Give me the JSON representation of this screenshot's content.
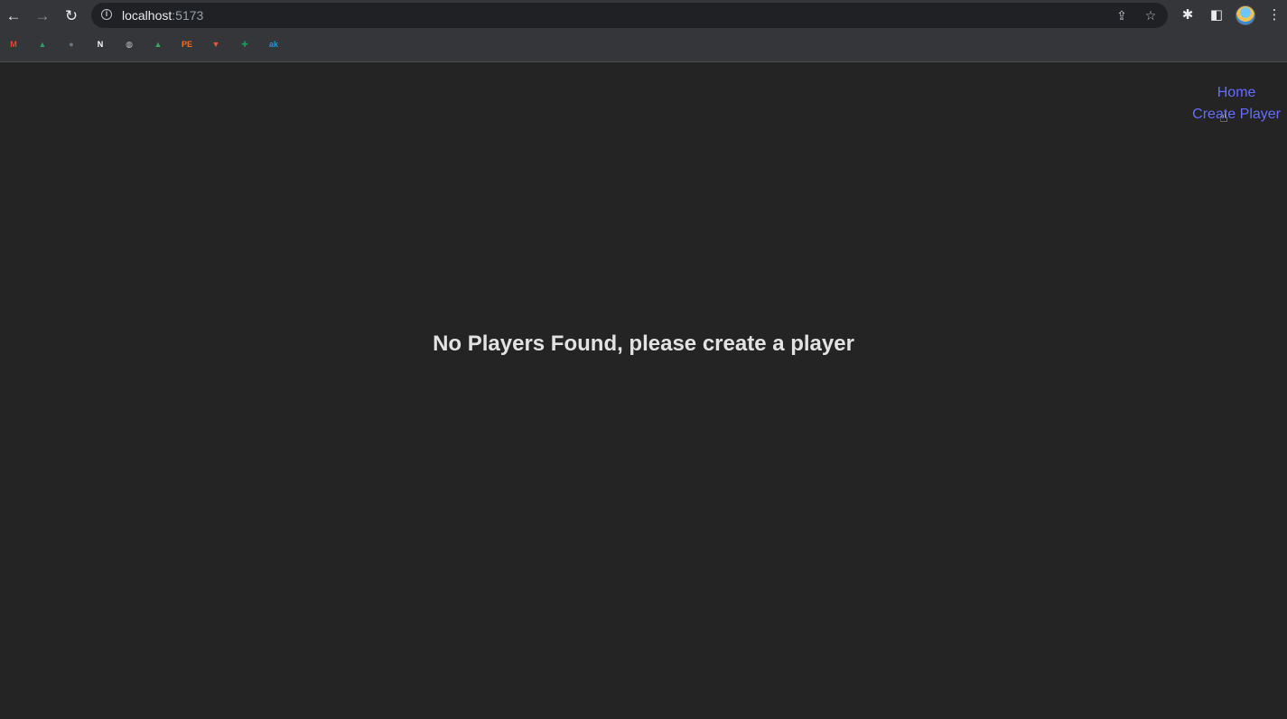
{
  "browser": {
    "url_host": "localhost",
    "url_port": ":5173",
    "nav": {
      "back_icon": "arrow-left-icon",
      "forward_icon": "arrow-right-icon",
      "reload_icon": "reload-icon"
    },
    "bookmarks": [
      {
        "name": "gmail-icon",
        "glyph": "M",
        "color": "#ea4335"
      },
      {
        "name": "google-drive-icon",
        "glyph": "▲",
        "color": "#1fa463"
      },
      {
        "name": "github-icon",
        "glyph": "●",
        "color": "#6e7681"
      },
      {
        "name": "notion-icon",
        "glyph": "N",
        "color": "#ffffff"
      },
      {
        "name": "globe-icon",
        "glyph": "◍",
        "color": "#bdc1c6"
      },
      {
        "name": "rocket-icon",
        "glyph": "▲",
        "color": "#34a853"
      },
      {
        "name": "pe-icon",
        "glyph": "PE",
        "color": "#f26c22"
      },
      {
        "name": "brave-icon",
        "glyph": "▼",
        "color": "#fb542b"
      },
      {
        "name": "sheets-icon",
        "glyph": "✚",
        "color": "#0f9d58"
      },
      {
        "name": "ak-icon",
        "glyph": "ak",
        "color": "#1a9ad6"
      }
    ]
  },
  "app": {
    "nav": {
      "home_label": "Home",
      "create_label": "Create Player"
    },
    "empty_message": "No Players Found, please create a player"
  }
}
